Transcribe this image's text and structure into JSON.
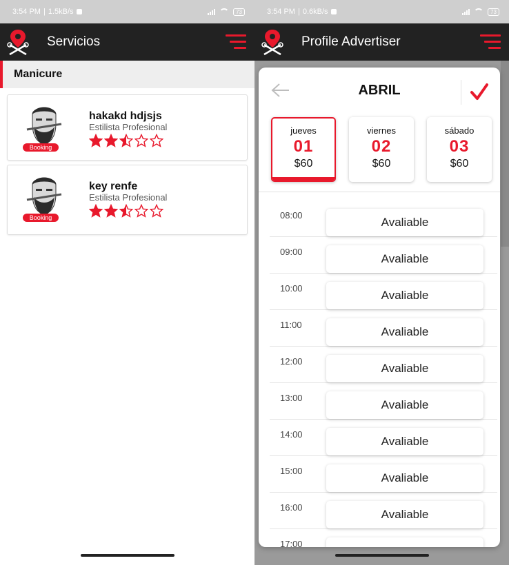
{
  "left_screen": {
    "status": {
      "time": "3:54 PM",
      "speed": "1.5kB/s",
      "battery": "73"
    },
    "appbar": {
      "title": "Servicios",
      "logo_icon": "scissors-pin-logo-icon",
      "menu_icon": "menu-icon"
    },
    "section": {
      "title": "Manicure"
    },
    "cards": [
      {
        "name": "hakakd hdjsjs",
        "role": "Estilista Profesional",
        "badge": "Booking",
        "rating": 2.5,
        "max_rating": 5
      },
      {
        "name": "key renfe",
        "role": "Estilista Profesional",
        "badge": "Booking",
        "rating": 2.5,
        "max_rating": 5
      }
    ]
  },
  "right_screen": {
    "status": {
      "time": "3:54 PM",
      "speed": "0.6kB/s",
      "battery": "73"
    },
    "appbar": {
      "title": "Profile Advertiser",
      "logo_icon": "scissors-pin-logo-icon",
      "menu_icon": "menu-icon"
    },
    "modal": {
      "month": "ABRIL",
      "back_icon": "arrow-left-icon",
      "confirm_icon": "check-icon",
      "days": [
        {
          "name": "jueves",
          "number": "01",
          "price": "$60",
          "selected": true
        },
        {
          "name": "viernes",
          "number": "02",
          "price": "$60",
          "selected": false
        },
        {
          "name": "sábado",
          "number": "03",
          "price": "$60",
          "selected": false
        }
      ],
      "slots": [
        {
          "time": "08:00",
          "label": "Avaliable"
        },
        {
          "time": "09:00",
          "label": "Avaliable"
        },
        {
          "time": "10:00",
          "label": "Avaliable"
        },
        {
          "time": "11:00",
          "label": "Avaliable"
        },
        {
          "time": "12:00",
          "label": "Avaliable"
        },
        {
          "time": "13:00",
          "label": "Avaliable"
        },
        {
          "time": "14:00",
          "label": "Avaliable"
        },
        {
          "time": "15:00",
          "label": "Avaliable"
        },
        {
          "time": "16:00",
          "label": "Avaliable"
        },
        {
          "time": "17:00",
          "label": ""
        }
      ]
    }
  },
  "colors": {
    "accent": "#e8192c",
    "appbar": "#222222",
    "statusbar": "#cfcfcf"
  }
}
